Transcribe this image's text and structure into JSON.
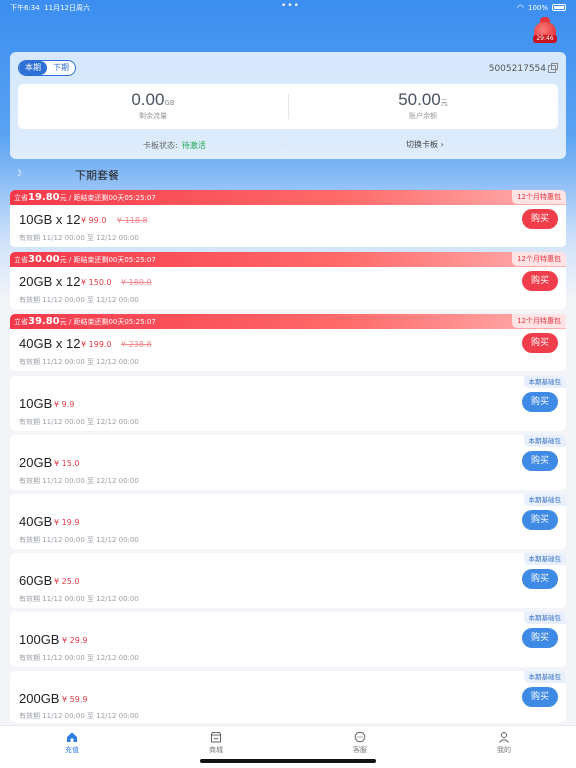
{
  "status_bar": {
    "time": "下午6:34",
    "date": "11月12日周六",
    "battery": "100%"
  },
  "promo_bag": {
    "timer": "29:46"
  },
  "account": {
    "period_tabs": [
      "本期",
      "下期"
    ],
    "active_period": "本期",
    "card_number": "5005217554",
    "remaining_flow": {
      "value": "0.00",
      "unit": "GB",
      "label": "剩余流量"
    },
    "balance": {
      "value": "50.00",
      "unit": "元",
      "label": "账户余额"
    },
    "card_state_label": "卡板状态:",
    "card_state_value": "待激活",
    "switch_card": "切换卡板 ›"
  },
  "section": {
    "title": "下期套餐"
  },
  "promo_packages": [
    {
      "save_prefix": "立省",
      "save_amount": "19.80",
      "countdown": "元 / 距结束还剩00天05:25:07",
      "tag": "12个月特惠包",
      "name": "10GB x 12",
      "price": "¥ 99.0",
      "old_price": "¥ 118.8",
      "validity": "有效期 11/12 00:00 至 12/12 00:00",
      "buy": "购买"
    },
    {
      "save_prefix": "立省",
      "save_amount": "30.00",
      "countdown": "元 / 距结束还剩00天05:25:07",
      "tag": "12个月特惠包",
      "name": "20GB x 12",
      "price": "¥ 150.0",
      "old_price": "¥ 180.0",
      "validity": "有效期 11/12 00:00 至 12/12 00:00",
      "buy": "购买"
    },
    {
      "save_prefix": "立省",
      "save_amount": "39.80",
      "countdown": "元 / 距结束还剩00天05:25:07",
      "tag": "12个月特惠包",
      "name": "40GB x 12",
      "price": "¥ 199.0",
      "old_price": "¥ 238.8",
      "validity": "有效期 11/12 00:00 至 12/12 00:00",
      "buy": "购买"
    }
  ],
  "base_packages": [
    {
      "tag": "本期基础包",
      "name": "10GB",
      "price": "¥ 9.9",
      "validity": "有效期 11/12 00:00 至 12/12 00:00",
      "buy": "购买"
    },
    {
      "tag": "本期基础包",
      "name": "20GB",
      "price": "¥ 15.0",
      "validity": "有效期 11/12 00:00 至 12/12 00:00",
      "buy": "购买"
    },
    {
      "tag": "本期基础包",
      "name": "40GB",
      "price": "¥ 19.9",
      "validity": "有效期 11/12 00:00 至 12/12 00:00",
      "buy": "购买"
    },
    {
      "tag": "本期基础包",
      "name": "60GB",
      "price": "¥ 25.0",
      "validity": "有效期 11/12 00:00 至 12/12 00:00",
      "buy": "购买"
    },
    {
      "tag": "本期基础包",
      "name": "100GB",
      "price": "¥ 29.9",
      "validity": "有效期 11/12 00:00 至 12/12 00:00",
      "buy": "购买"
    },
    {
      "tag": "本期基础包",
      "name": "200GB",
      "price": "¥ 59.9",
      "validity": "有效期 11/12 00:00 至 12/12 00:00",
      "buy": "购买"
    }
  ],
  "tabbar": [
    {
      "label": "充值",
      "icon": "home-icon",
      "active": true
    },
    {
      "label": "商城",
      "icon": "store-icon",
      "active": false
    },
    {
      "label": "客服",
      "icon": "chat-icon",
      "active": false
    },
    {
      "label": "我的",
      "icon": "user-icon",
      "active": false
    }
  ],
  "colors": {
    "primary": "#3f8ae4",
    "promo_red": "#ef3d4b",
    "active_green": "#1fa34a"
  }
}
